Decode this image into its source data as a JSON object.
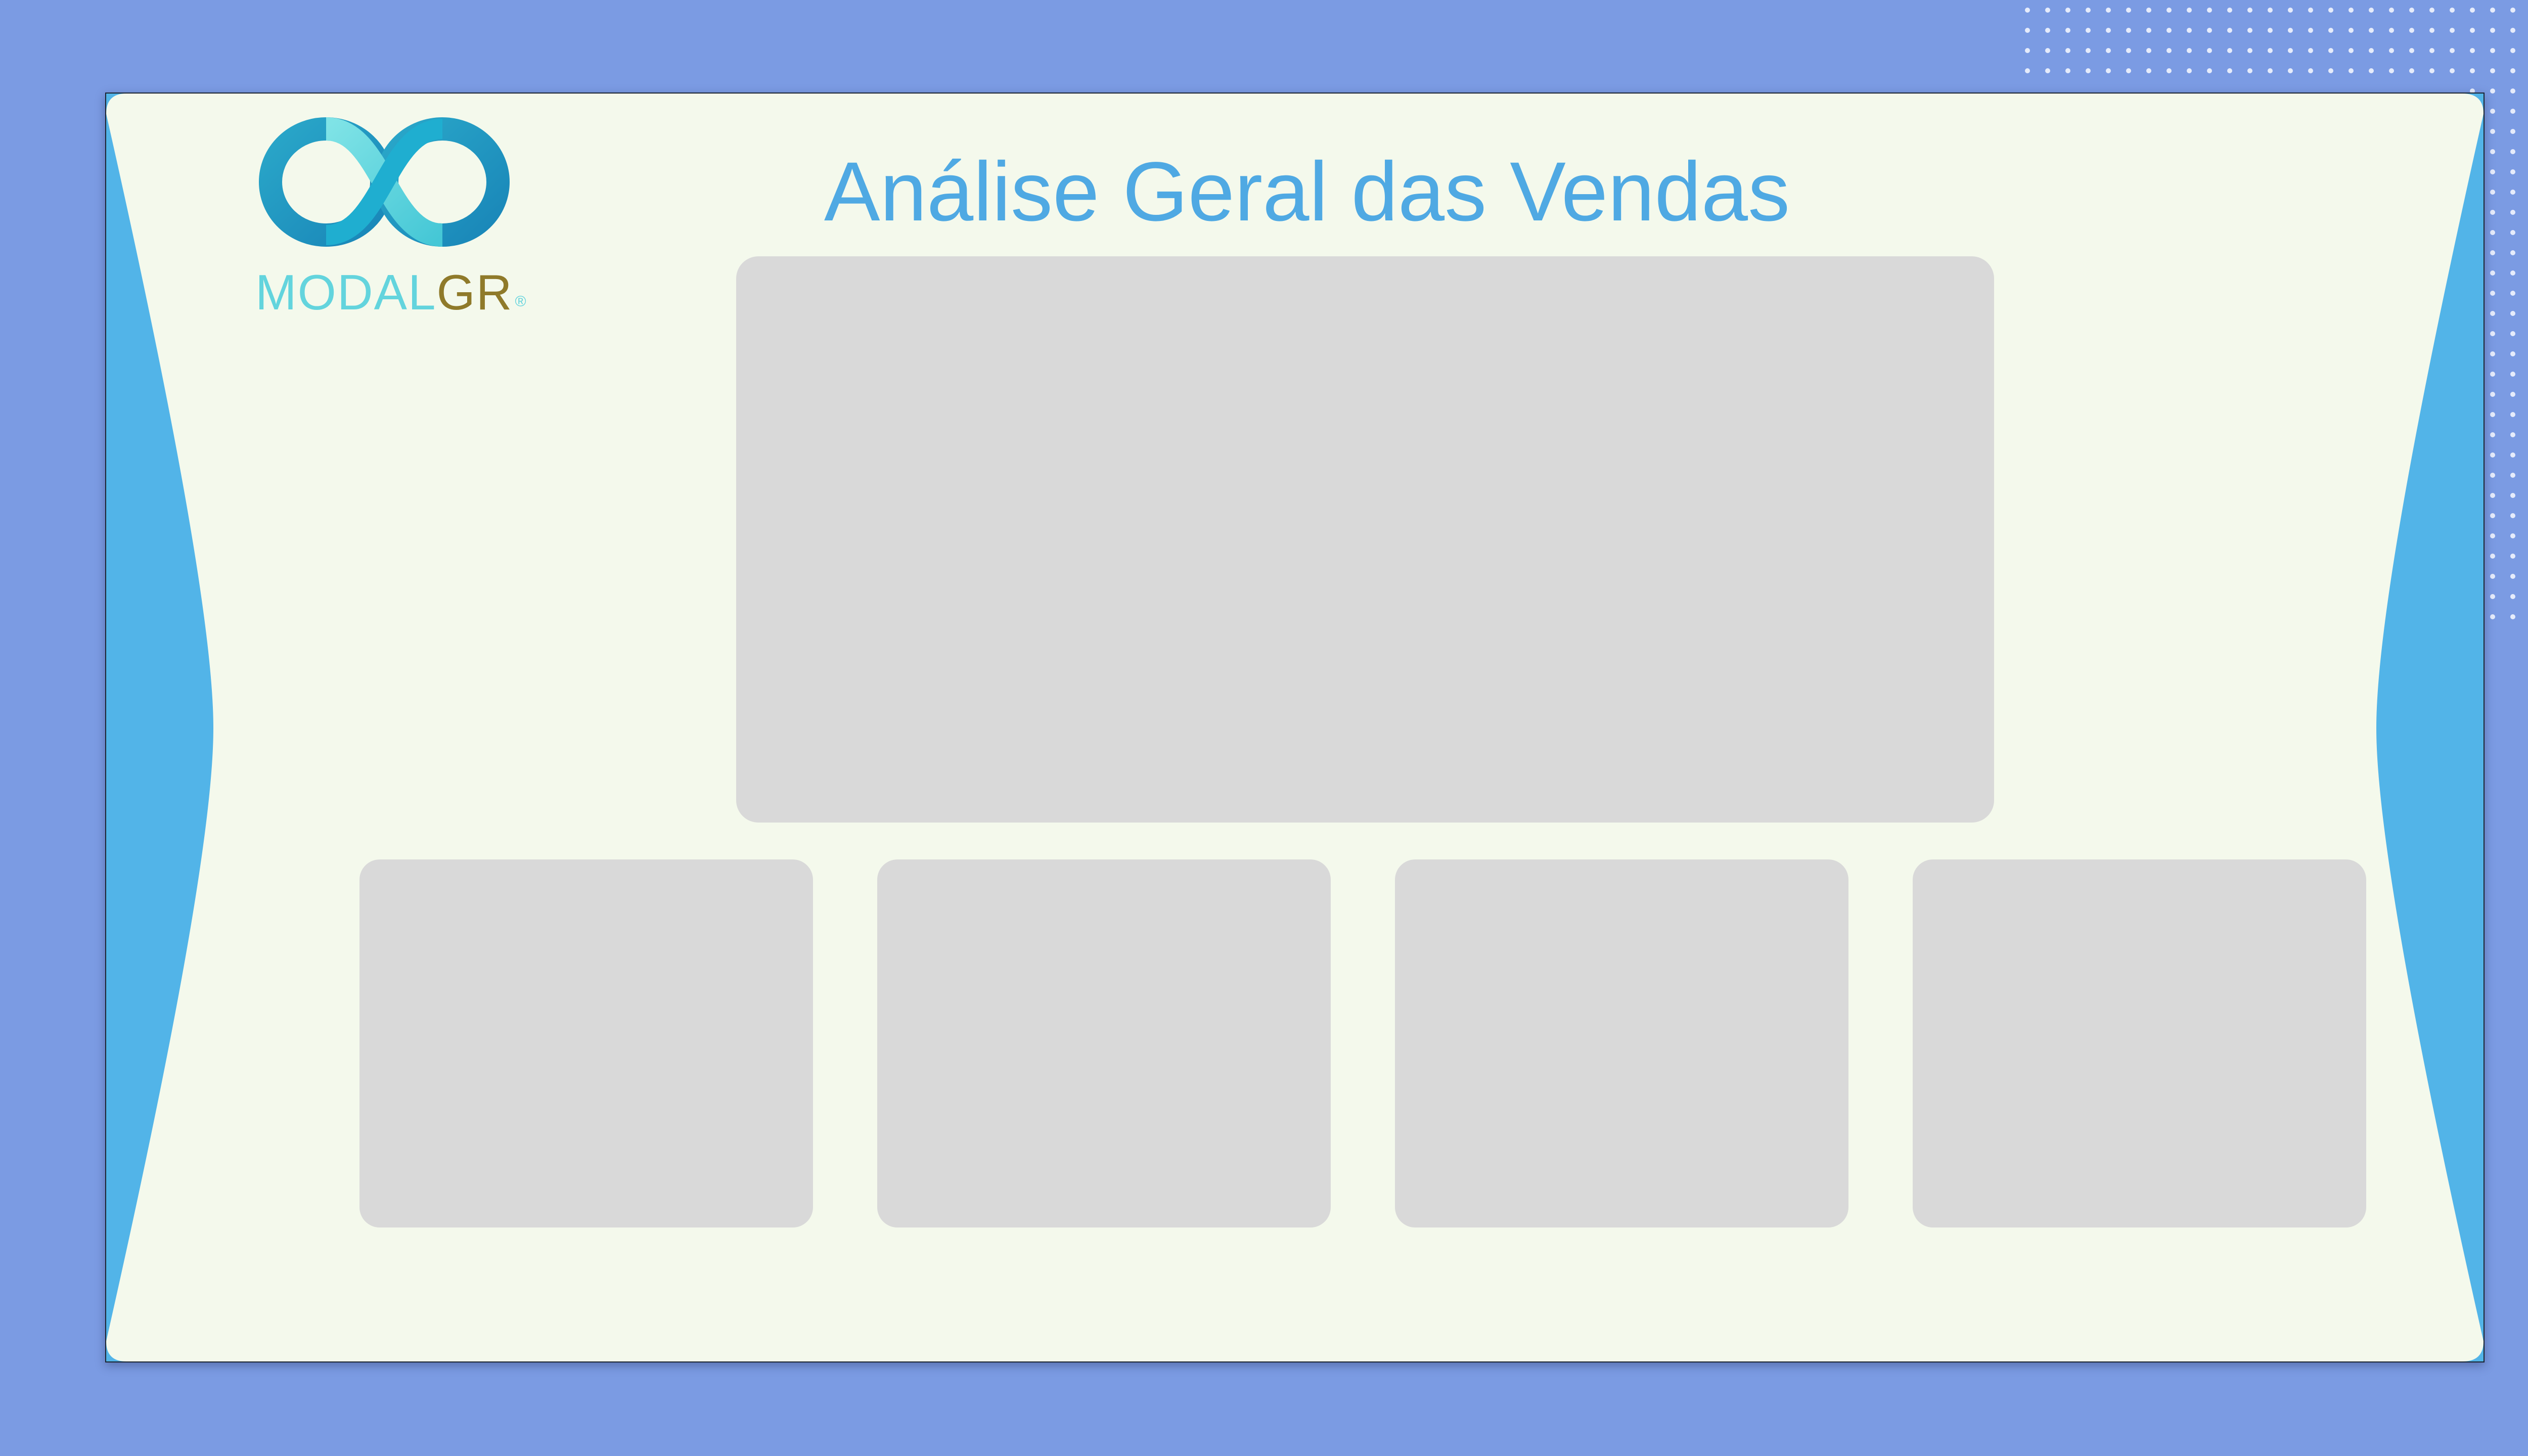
{
  "page": {
    "title": "Análise Geral das Vendas"
  },
  "logo": {
    "name_part1": "MODAL",
    "name_part2": "GR",
    "registered": "®",
    "icon": "infinity-logo-icon"
  },
  "colors": {
    "background": "#7b9be3",
    "panel": "#f4f9ec",
    "side_accent": "#52b4e8",
    "title": "#4fa9e3",
    "card_placeholder": "#d9d9d9",
    "logo_teal": "#63d4dd",
    "logo_gold": "#8f7a2a"
  },
  "cards": [
    {
      "id": "main-visual-placeholder"
    },
    {
      "id": "kpi-card-1"
    },
    {
      "id": "kpi-card-2"
    },
    {
      "id": "kpi-card-3"
    },
    {
      "id": "kpi-card-4"
    }
  ]
}
